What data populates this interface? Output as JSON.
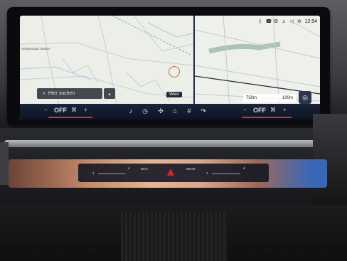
{
  "status": {
    "time": "12:54",
    "icons": [
      "bluetooth-icon",
      "phone-icon",
      "settings-icon",
      "music-icon",
      "volume-icon",
      "mute-icon"
    ]
  },
  "map": {
    "town_label": "Seligenstadt Station",
    "search_placeholder": "Hier suchen",
    "destination": "Wien",
    "route_distance": "750m",
    "route_scale": "100m"
  },
  "climate": {
    "left_minus": "−",
    "left_state": "OFF",
    "left_plus": "+",
    "right_minus": "−",
    "right_state": "OFF",
    "right_plus": "+"
  },
  "dock": {
    "icons": [
      "music-icon",
      "phone-icon",
      "fan-icon",
      "home-icon",
      "apps-icon",
      "seat-heat-icon"
    ]
  },
  "panel": {
    "max_label": "MAX",
    "rear_label": "REAR",
    "left_value": "4",
    "right_value": "4",
    "left_marker": "1",
    "right_marker": "1"
  },
  "colors": {
    "accent_red": "#d42b2b",
    "hazard_red": "#e02020",
    "bar_blue": "#1a2438"
  }
}
